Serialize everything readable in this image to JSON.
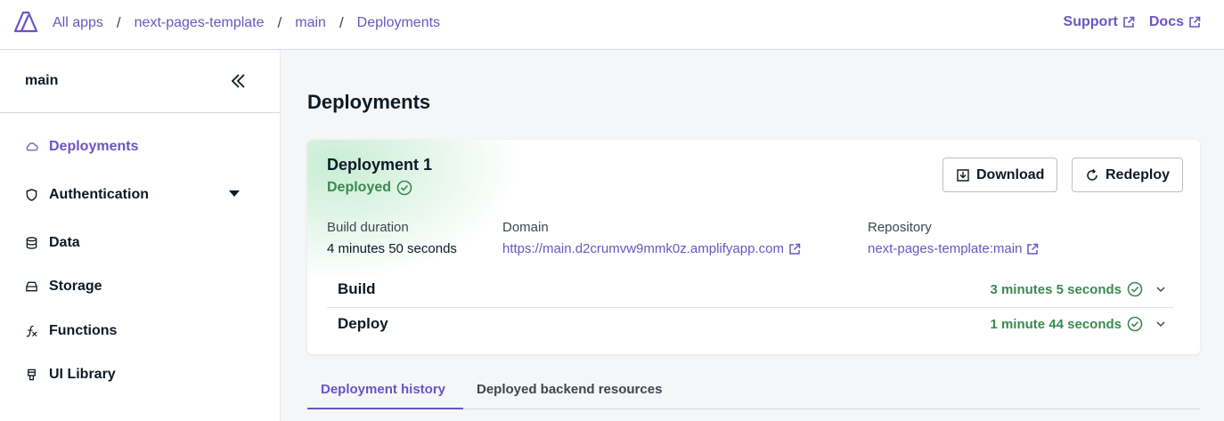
{
  "breadcrumb": [
    "All apps",
    "next-pages-template",
    "main",
    "Deployments"
  ],
  "top_links": {
    "support": "Support",
    "docs": "Docs"
  },
  "sidebar": {
    "title": "main",
    "items": [
      {
        "label": "Deployments",
        "icon": "cloud-icon",
        "active": true
      },
      {
        "label": "Authentication",
        "icon": "shield-icon"
      },
      {
        "label": "Data",
        "icon": "database-icon"
      },
      {
        "label": "Storage",
        "icon": "storage-icon"
      },
      {
        "label": "Functions",
        "icon": "function-icon"
      },
      {
        "label": "UI Library",
        "icon": "ui-library-icon"
      }
    ]
  },
  "main": {
    "title": "Deployments",
    "deployment": {
      "name": "Deployment 1",
      "status": "Deployed",
      "download_label": "Download",
      "redeploy_label": "Redeploy",
      "build_duration_label": "Build duration",
      "build_duration": "4 minutes 50 seconds",
      "domain_label": "Domain",
      "domain": "https://main.d2crumvw9mmk0z.amplifyapp.com",
      "repository_label": "Repository",
      "repository": "next-pages-template:main",
      "steps": [
        {
          "name": "Build",
          "time": "3 minutes 5 seconds"
        },
        {
          "name": "Deploy",
          "time": "1 minute 44 seconds"
        }
      ]
    },
    "tabs": [
      "Deployment history",
      "Deployed backend resources"
    ]
  },
  "colors": {
    "accent": "#6b55c2",
    "success": "#3a8a4f"
  }
}
